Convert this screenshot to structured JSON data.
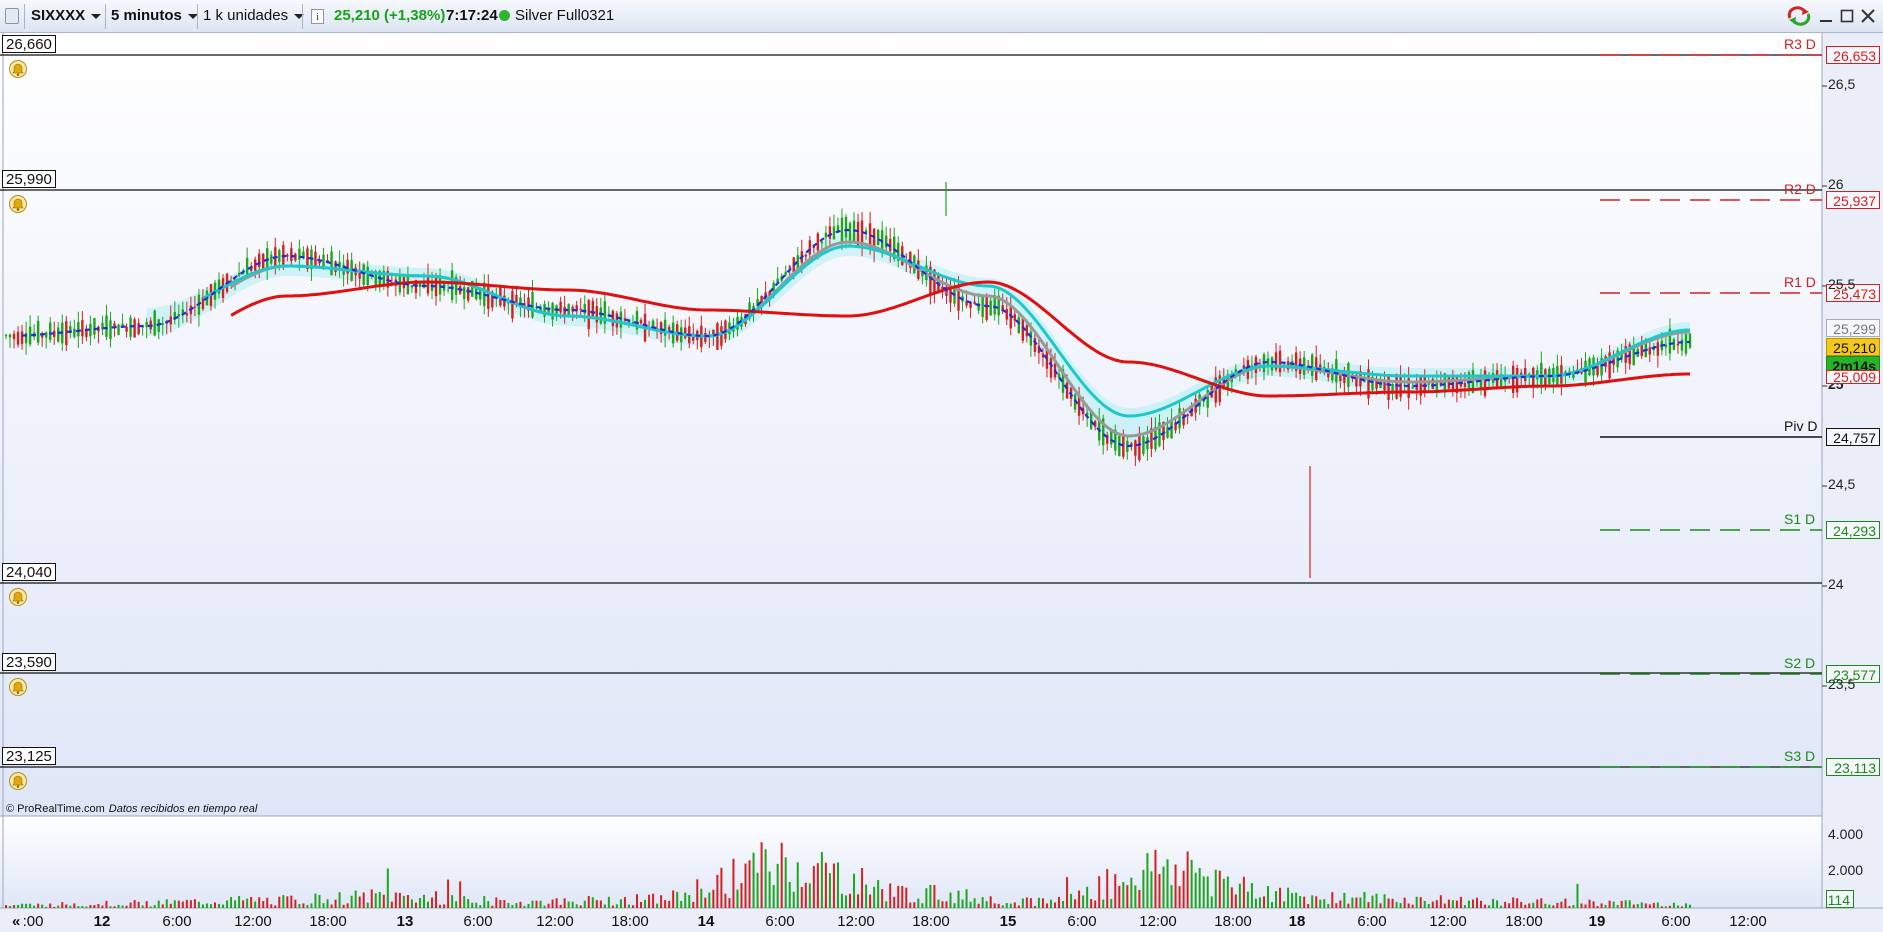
{
  "toolbar": {
    "symbol": "SIXXXX",
    "timeframe": "5 minutos",
    "units": "1 k unidades",
    "info_glyph": "i",
    "price": "25,210 (+1,38%)",
    "time": "7:17:24",
    "feed": "Silver Full0321",
    "icons": [
      "grip-icon",
      "info-icon",
      "status-dot-icon",
      "refresh-icon",
      "minimize-icon",
      "maximize-icon",
      "close-icon"
    ],
    "colors": {
      "price": "#17a317",
      "dot": "#2db52d"
    }
  },
  "alerts": {
    "levels": [
      "26,660",
      "25,990",
      "24,040",
      "23,590",
      "23,125"
    ],
    "icon": "bell-icon"
  },
  "pivots": [
    {
      "name": "R3 D",
      "value": "26,653",
      "color": "#d32020"
    },
    {
      "name": "R2 D",
      "value": "25,937",
      "color": "#d32020"
    },
    {
      "name": "R1 D",
      "value": "25,473",
      "color": "#d32020"
    },
    {
      "name": "Piv D",
      "value": "24,757",
      "color": "#111111"
    },
    {
      "name": "S1 D",
      "value": "24,293",
      "color": "#1b8a1b"
    },
    {
      "name": "S2 D",
      "value": "23,577",
      "color": "#1b8a1b"
    },
    {
      "name": "S3 D",
      "value": "23,113",
      "color": "#1b8a1b"
    }
  ],
  "price_axis": {
    "ticks": [
      "26,5",
      "26",
      "25,5",
      "25",
      "24,5",
      "24",
      "23,5"
    ],
    "labels": {
      "cloud_top": "25,299",
      "last": "25,210",
      "countdown": "2m14s",
      "ma": "25,009",
      "ma_partial": "25,009"
    }
  },
  "credit": {
    "site": "© ProRealTime.com",
    "note": "Datos recibidos en tiempo real"
  },
  "volume_axis": {
    "ticks": [
      "4.000",
      "2.000"
    ],
    "last": "114"
  },
  "time_axis": {
    "nav": "«",
    "labels": [
      ":00",
      "12",
      "6:00",
      "12:00",
      "18:00",
      "13",
      "6:00",
      "12:00",
      "18:00",
      "14",
      "6:00",
      "12:00",
      "18:00",
      "15",
      "6:00",
      "12:00",
      "18:00",
      "18",
      "6:00",
      "12:00",
      "18:00",
      "19",
      "6:00",
      "12:00"
    ],
    "day_markers": [
      "12",
      "13",
      "14",
      "15",
      "18",
      "19"
    ]
  },
  "chart_data": {
    "type": "line",
    "title": "",
    "xlabel": "",
    "ylabel": "",
    "ylim": [
      23.0,
      26.7
    ],
    "x": [
      "12 00:00",
      "12 12:00",
      "13 00:00",
      "13 12:00",
      "14 00:00",
      "14 12:00",
      "15 00:00",
      "15 12:00",
      "18 00:00",
      "18 06:00",
      "18 12:00",
      "19 00:00",
      "19 06:00"
    ],
    "series": [
      {
        "values": [
          25.25,
          25.3,
          25.65,
          25.5,
          25.38,
          25.25,
          25.78,
          25.4,
          24.7,
          25.12,
          25.0,
          25.05,
          25.22
        ]
      },
      {
        "values": [
          25.2,
          25.35,
          25.6,
          25.55,
          25.35,
          25.25,
          25.7,
          25.5,
          24.85,
          25.1,
          25.05,
          25.05,
          25.28
        ]
      },
      {
        "values": [
          null,
          25.17,
          25.45,
          25.52,
          25.48,
          25.38,
          25.35,
          25.52,
          25.12,
          24.95,
          24.97,
          25.0,
          25.06
        ]
      },
      {
        "values": [
          null,
          25.3,
          25.6,
          25.55,
          25.35,
          25.25,
          25.72,
          25.45,
          24.75,
          25.1,
          25.02,
          25.05,
          25.27
        ]
      }
    ],
    "volume": [
      300,
      500,
      800,
      1200,
      600,
      900,
      4500,
      1500,
      700,
      4200,
      1200,
      800,
      600,
      400
    ],
    "last_price": 25.21,
    "colors": {
      "ma_long": "#e01010",
      "ma_short": "#1ec8c8",
      "kijun": "#999999",
      "tenkan": "#1f2fd6",
      "candles_up": "#1ea51e",
      "candles_down": "#d32020",
      "cloud": "#aeeef4"
    }
  }
}
